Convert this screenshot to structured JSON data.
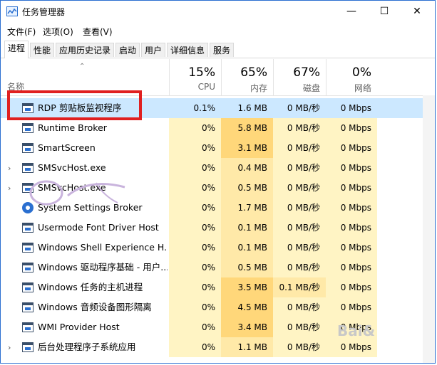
{
  "window": {
    "title": "任务管理器",
    "min": "—",
    "max": "☐",
    "close": "✕"
  },
  "menu": [
    "文件(F)",
    "选项(O)",
    "查看(V)"
  ],
  "tabs": [
    "进程",
    "性能",
    "应用历史记录",
    "启动",
    "用户",
    "详细信息",
    "服务"
  ],
  "columns": {
    "name": {
      "label": "名称"
    },
    "cpu": {
      "pct": "15%",
      "label": "CPU"
    },
    "mem": {
      "pct": "65%",
      "label": "内存"
    },
    "disk": {
      "pct": "67%",
      "label": "磁盘"
    },
    "net": {
      "pct": "0%",
      "label": "网络"
    }
  },
  "rows": [
    {
      "name": "RDP 剪贴板监视程序",
      "cpu": "0.1%",
      "mem": "1.6 MB",
      "disk": "0 MB/秒",
      "net": "0 Mbps",
      "icon": "window-app-icon"
    },
    {
      "name": "Runtime Broker",
      "cpu": "0%",
      "mem": "5.8 MB",
      "disk": "0 MB/秒",
      "net": "0 Mbps",
      "icon": "window-app-icon"
    },
    {
      "name": "SmartScreen",
      "cpu": "0%",
      "mem": "3.1 MB",
      "disk": "0 MB/秒",
      "net": "0 Mbps",
      "icon": "window-app-icon"
    },
    {
      "name": "SMSvcHost.exe",
      "cpu": "0%",
      "mem": "0.4 MB",
      "disk": "0 MB/秒",
      "net": "0 Mbps",
      "icon": "window-app-icon"
    },
    {
      "name": "SMSvcHost.exe",
      "cpu": "0%",
      "mem": "0.5 MB",
      "disk": "0 MB/秒",
      "net": "0 Mbps",
      "icon": "window-app-icon"
    },
    {
      "name": "System Settings Broker",
      "cpu": "0%",
      "mem": "1.7 MB",
      "disk": "0 MB/秒",
      "net": "0 Mbps",
      "icon": "gear-icon"
    },
    {
      "name": "Usermode Font Driver Host",
      "cpu": "0%",
      "mem": "0.1 MB",
      "disk": "0 MB/秒",
      "net": "0 Mbps",
      "icon": "window-app-icon"
    },
    {
      "name": "Windows Shell Experience H...",
      "cpu": "0%",
      "mem": "0.1 MB",
      "disk": "0 MB/秒",
      "net": "0 Mbps",
      "icon": "window-app-icon"
    },
    {
      "name": "Windows 驱动程序基础 - 用户...",
      "cpu": "0%",
      "mem": "0.5 MB",
      "disk": "0 MB/秒",
      "net": "0 Mbps",
      "icon": "window-app-icon"
    },
    {
      "name": "Windows 任务的主机进程",
      "cpu": "0%",
      "mem": "3.5 MB",
      "disk": "0.1 MB/秒",
      "net": "0 Mbps",
      "icon": "window-app-icon"
    },
    {
      "name": "Windows 音频设备图形隔离",
      "cpu": "0%",
      "mem": "4.5 MB",
      "disk": "0 MB/秒",
      "net": "0 Mbps",
      "icon": "window-app-icon"
    },
    {
      "name": "WMI Provider Host",
      "cpu": "0%",
      "mem": "3.4 MB",
      "disk": "0 MB/秒",
      "net": "0 Mbps",
      "icon": "window-app-icon"
    },
    {
      "name": "后台处理程序子系统应用",
      "cpu": "0%",
      "mem": "1.1 MB",
      "disk": "0 MB/秒",
      "net": "0 Mbps",
      "icon": "window-app-icon"
    }
  ],
  "watermark": "Bai&"
}
